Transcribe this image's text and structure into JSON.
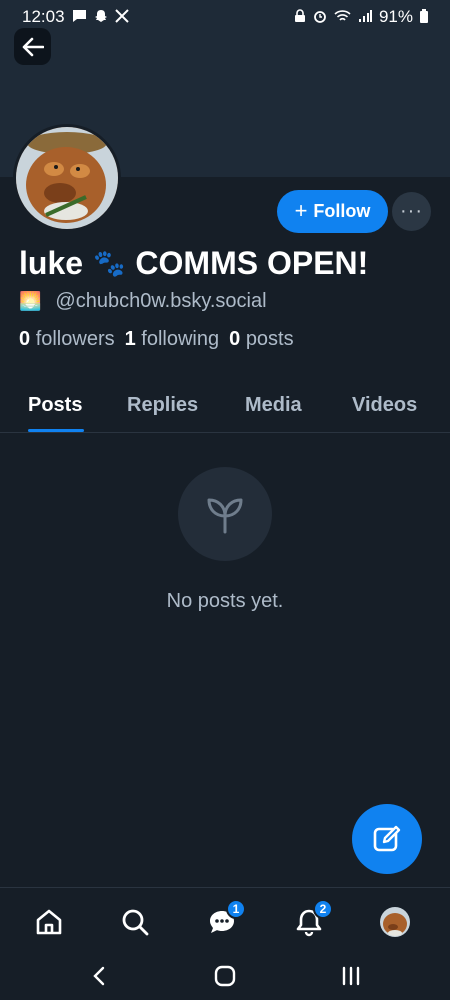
{
  "status_bar": {
    "time": "12:03",
    "battery": "91%",
    "left_icons": [
      "message-icon",
      "snapchat-icon",
      "x-icon"
    ],
    "right_icons": [
      "vpn-icon",
      "alarm-icon",
      "wifi-icon",
      "signal-icon",
      "battery-icon"
    ]
  },
  "profile": {
    "display_name": "luke",
    "display_name_emoji": "🐾",
    "display_name_suffix": "COMMS OPEN!",
    "handle_emoji": "🌅",
    "handle": "@chubch0w.bsky.social",
    "followers_count": "0",
    "followers_label": "followers",
    "following_count": "1",
    "following_label": "following",
    "posts_count": "0",
    "posts_label": "posts"
  },
  "actions": {
    "follow_plus": "+",
    "follow_label": "Follow",
    "more_label": "···"
  },
  "tabs": [
    {
      "label": "Posts",
      "active": true
    },
    {
      "label": "Replies",
      "active": false
    },
    {
      "label": "Media",
      "active": false
    },
    {
      "label": "Videos",
      "active": false
    }
  ],
  "empty_state": {
    "icon": "sprout-icon",
    "text": "No posts yet."
  },
  "bottom_nav": {
    "items": [
      "home-icon",
      "search-icon",
      "chat-icon",
      "bell-icon",
      "avatar"
    ],
    "chat_badge": "1",
    "notifications_badge": "2"
  },
  "colors": {
    "background": "#161e27",
    "banner": "#1e2a37",
    "accent": "#1082f0",
    "muted_text": "#aebbc9"
  }
}
